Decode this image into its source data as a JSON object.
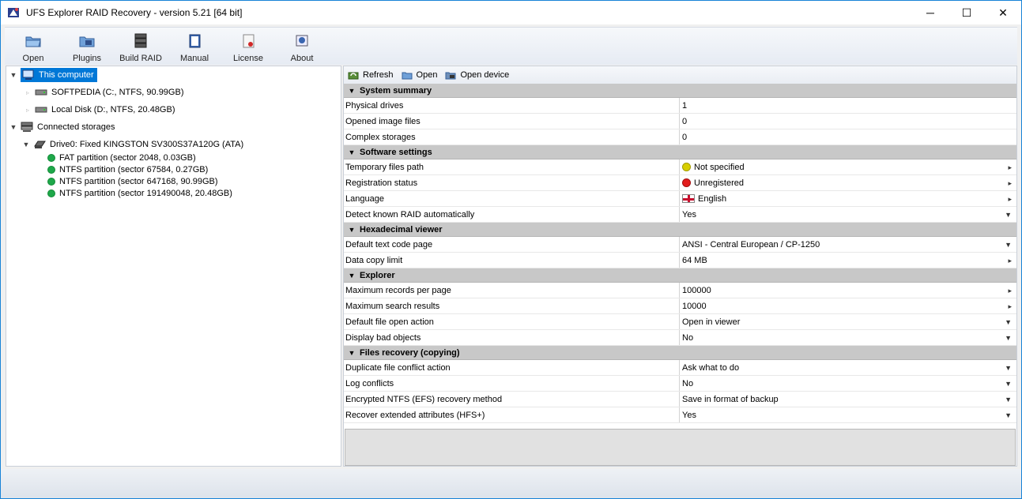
{
  "window": {
    "title": "UFS Explorer RAID Recovery - version 5.21 [64 bit]",
    "controls": {
      "minimize": "─",
      "maximize": "☐",
      "close": "✕"
    }
  },
  "toolbar": {
    "items": [
      {
        "label": "Open",
        "icon": "open-folder-icon"
      },
      {
        "label": "Plugins",
        "icon": "plugins-icon"
      },
      {
        "label": "Build RAID",
        "icon": "build-raid-icon"
      },
      {
        "label": "Manual",
        "icon": "manual-icon"
      },
      {
        "label": "License",
        "icon": "license-icon"
      },
      {
        "label": "About",
        "icon": "about-icon"
      }
    ]
  },
  "tree": {
    "this_computer": "This computer",
    "disks": [
      "SOFTPEDIA (C:, NTFS, 90.99GB)",
      "Local Disk (D:, NTFS, 20.48GB)"
    ],
    "connected_storages": "Connected storages",
    "drive": "Drive0: Fixed KINGSTON SV300S37A120G (ATA)",
    "partitions": [
      "FAT partition (sector 2048, 0.03GB)",
      "NTFS partition (sector 67584, 0.27GB)",
      "NTFS partition (sector 647168, 90.99GB)",
      "NTFS partition (sector 191490048, 20.48GB)"
    ]
  },
  "right_toolbar": {
    "refresh": "Refresh",
    "open": "Open",
    "open_device": "Open device"
  },
  "properties": {
    "system_summary": {
      "title": "System summary",
      "rows": [
        {
          "name": "Physical drives",
          "value": "1"
        },
        {
          "name": "Opened image files",
          "value": "0"
        },
        {
          "name": "Complex storages",
          "value": "0"
        }
      ]
    },
    "software_settings": {
      "title": "Software settings",
      "rows": [
        {
          "name": "Temporary files path",
          "value": "Not specified"
        },
        {
          "name": "Registration status",
          "value": "Unregistered"
        },
        {
          "name": "Language",
          "value": "English"
        },
        {
          "name": "Detect known RAID automatically",
          "value": "Yes"
        }
      ]
    },
    "hex_viewer": {
      "title": "Hexadecimal viewer",
      "rows": [
        {
          "name": "Default text code page",
          "value": "ANSI - Central European / CP-1250"
        },
        {
          "name": "Data copy limit",
          "value": "64 MB"
        }
      ]
    },
    "explorer": {
      "title": "Explorer",
      "rows": [
        {
          "name": "Maximum records per page",
          "value": "100000"
        },
        {
          "name": "Maximum search results",
          "value": "10000"
        },
        {
          "name": "Default file open action",
          "value": "Open in viewer"
        },
        {
          "name": "Display bad objects",
          "value": "No"
        }
      ]
    },
    "files_recovery": {
      "title": "Files recovery (copying)",
      "rows": [
        {
          "name": "Duplicate file conflict action",
          "value": "Ask what to do"
        },
        {
          "name": "Log conflicts",
          "value": "No"
        },
        {
          "name": "Encrypted NTFS (EFS) recovery method",
          "value": "Save in format of backup"
        },
        {
          "name": "Recover extended attributes (HFS+)",
          "value": "Yes"
        }
      ]
    }
  },
  "glyphs": {
    "expanded": "▼",
    "leaf": "▹",
    "submenu": "▸",
    "dropdown": "▼"
  }
}
